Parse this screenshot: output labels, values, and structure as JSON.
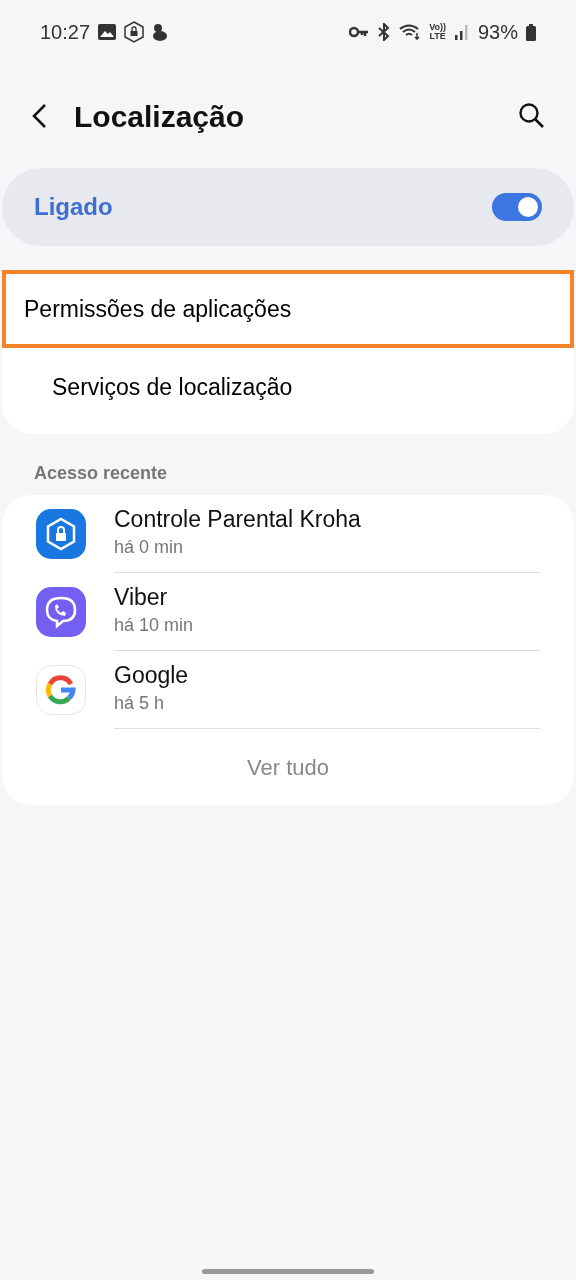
{
  "status_bar": {
    "time": "10:27",
    "network_label": [
      "Vo))",
      "LTE"
    ],
    "battery": "93%"
  },
  "header": {
    "title": "Localização"
  },
  "master_switch": {
    "label": "Ligado",
    "on": true
  },
  "menu": [
    {
      "label": "Permissões de aplicações",
      "highlighted": true
    },
    {
      "label": "Serviços de localização",
      "highlighted": false
    }
  ],
  "recent": {
    "heading": "Acesso recente",
    "apps": [
      {
        "name": "Controle Parental Kroha",
        "time": "há 0 min",
        "kind": "shield"
      },
      {
        "name": "Viber",
        "time": "há 10 min",
        "kind": "chat"
      },
      {
        "name": "Google",
        "time": "há 5 h",
        "kind": "g"
      }
    ],
    "see_all": "Ver tudo"
  }
}
